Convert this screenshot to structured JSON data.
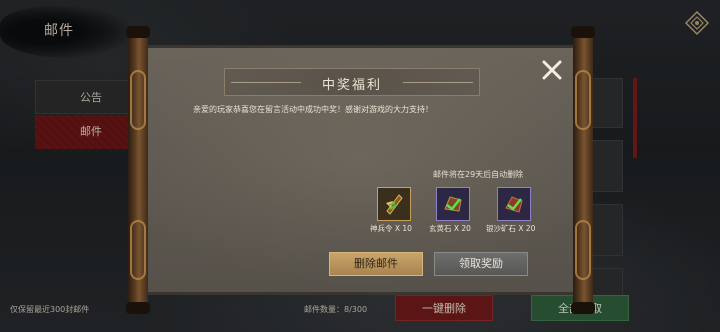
{
  "header": {
    "title": "邮件"
  },
  "tabs": [
    {
      "label": "公告"
    },
    {
      "label": "邮件"
    }
  ],
  "footer": {
    "retain_note": "仅保留最近300封邮件",
    "mail_count": "邮件数量：8/300",
    "delete_all_label": "一键删除",
    "claim_all_label": "全部领取"
  },
  "modal": {
    "title": "中奖福利",
    "message": "亲爱的玩家恭喜您在留言活动中成功中奖！感谢对游戏的大力支持！",
    "expire_note": "邮件将在29天后自动删除",
    "rewards": [
      {
        "label": "神兵令 X 10",
        "icon": "weapon-token-icon"
      },
      {
        "label": "玄黄石 X 20",
        "icon": "xuanhuang-stone-icon"
      },
      {
        "label": "银沙矿石 X 20",
        "icon": "silver-ore-icon"
      }
    ],
    "delete_label": "删除邮件",
    "claim_label": "领取奖励"
  },
  "colors": {
    "accent_red": "#6c1616",
    "accent_green": "#2f5f3a",
    "gold_button": "#c9a46a"
  }
}
